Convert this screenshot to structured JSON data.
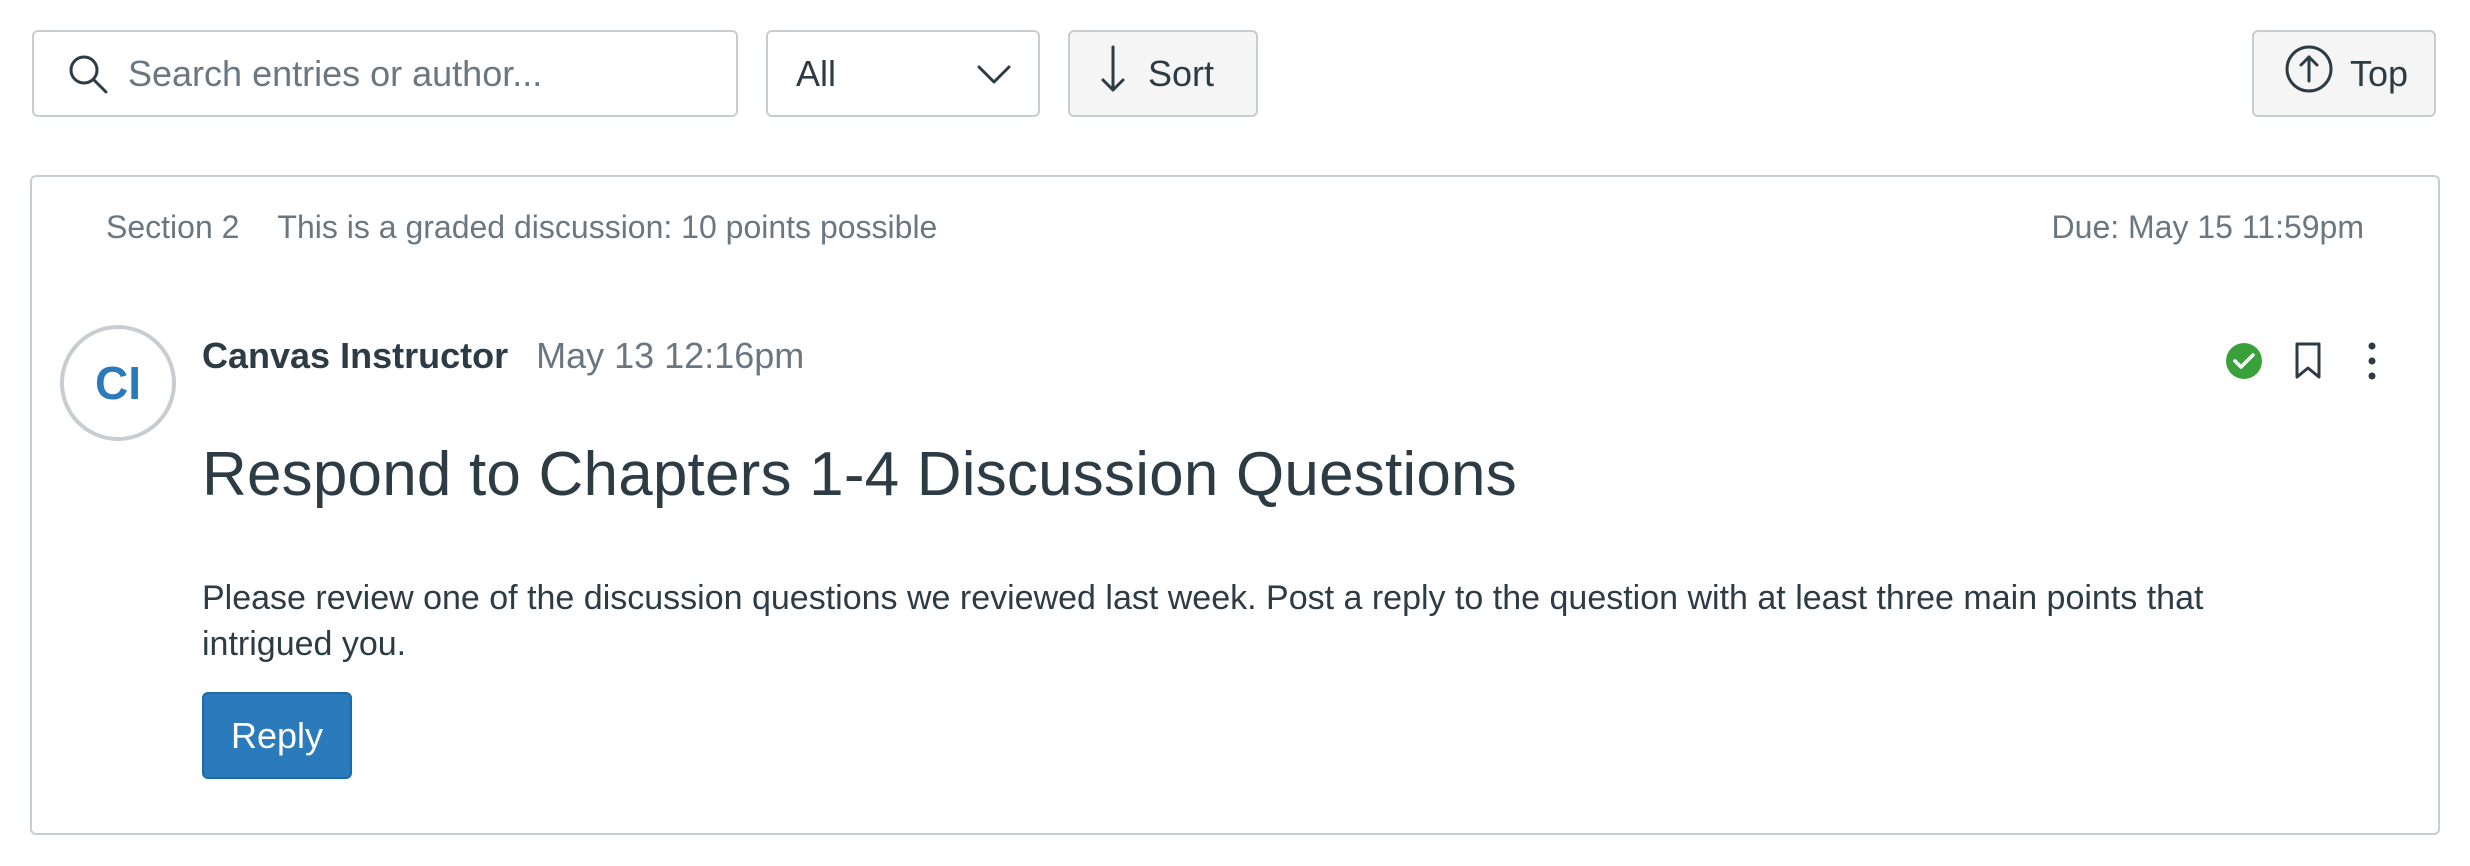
{
  "toolbar": {
    "search_placeholder": "Search entries or author...",
    "search_value": "",
    "filter_value": "All",
    "sort_label": "Sort",
    "top_label": "Top"
  },
  "discussion": {
    "section": "Section 2",
    "graded_note": "This is a graded discussion: 10 points possible",
    "due": "Due: May 15 11:59pm",
    "author_initials": "CI",
    "author_name": "Canvas Instructor",
    "posted_at": "May 13 12:16pm",
    "title": "Respond to Chapters 1-4 Discussion Questions",
    "body": "Please review one of the discussion questions we reviewed last week. Post a reply to the question with at least three main points that intrigued you.",
    "reply_label": "Reply"
  },
  "icons": {
    "search": "search-icon",
    "filter": "chevron-down-icon",
    "sort": "arrow-down-icon",
    "top": "arrow-up-circle-icon",
    "read": "check-circle-icon",
    "bookmark": "bookmark-icon",
    "more": "more-vertical-icon"
  },
  "colors": {
    "accent": "#2b7abc",
    "success": "#3aa13a",
    "text": "#2d3b45",
    "muted": "#6b7780",
    "border": "#c7cdd1"
  }
}
